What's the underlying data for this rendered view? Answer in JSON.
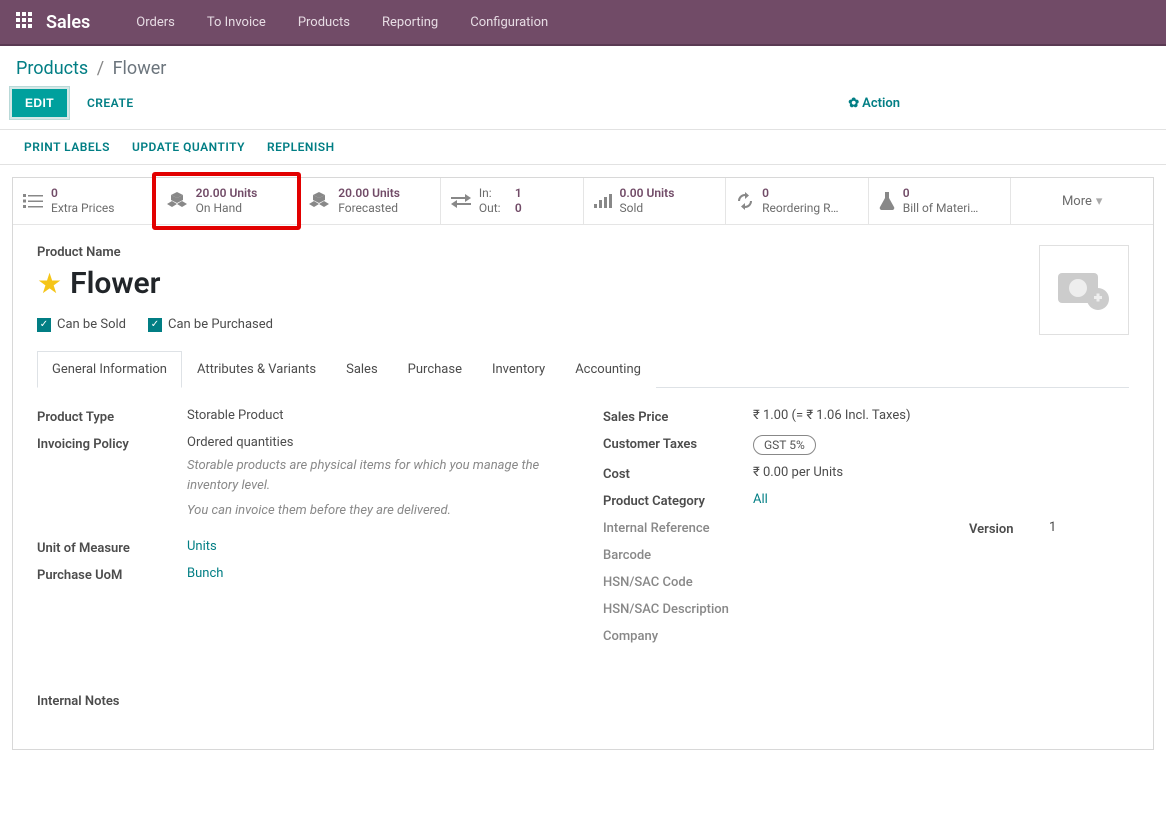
{
  "nav": {
    "app_title": "Sales",
    "items": [
      "Orders",
      "To Invoice",
      "Products",
      "Reporting",
      "Configuration"
    ]
  },
  "breadcrumb": {
    "root": "Products",
    "current": "Flower"
  },
  "actions": {
    "edit": "EDIT",
    "create": "CREATE",
    "action_label": "Action"
  },
  "toolbar2": {
    "print": "PRINT LABELS",
    "update": "UPDATE QUANTITY",
    "replenish": "REPLENISH"
  },
  "stats": {
    "extra_prices": {
      "value": "0",
      "label": "Extra Prices"
    },
    "on_hand": {
      "value": "20.00 Units",
      "label": "On Hand"
    },
    "forecasted": {
      "value": "20.00 Units",
      "label": "Forecasted"
    },
    "inout": {
      "in_label": "In:",
      "in_val": "1",
      "out_label": "Out:",
      "out_val": "0"
    },
    "sold": {
      "value": "0.00 Units",
      "label": "Sold"
    },
    "reordering": {
      "value": "0",
      "label": "Reordering R…"
    },
    "bom": {
      "value": "0",
      "label": "Bill of Materi…"
    },
    "more": "More"
  },
  "product": {
    "name_label": "Product Name",
    "name": "Flower",
    "can_be_sold": "Can be Sold",
    "can_be_purchased": "Can be Purchased"
  },
  "tabs": [
    "General Information",
    "Attributes & Variants",
    "Sales",
    "Purchase",
    "Inventory",
    "Accounting"
  ],
  "fields_left": {
    "product_type": {
      "label": "Product Type",
      "value": "Storable Product"
    },
    "invoicing_policy": {
      "label": "Invoicing Policy",
      "value": "Ordered quantities",
      "hint1": "Storable products are physical items for which you manage the inventory level.",
      "hint2": "You can invoice them before they are delivered."
    },
    "uom": {
      "label": "Unit of Measure",
      "value": "Units"
    },
    "purchase_uom": {
      "label": "Purchase UoM",
      "value": "Bunch"
    }
  },
  "fields_right": {
    "sales_price": {
      "label": "Sales Price",
      "value": "₹ 1.00  (= ₹ 1.06 Incl. Taxes)"
    },
    "customer_taxes": {
      "label": "Customer Taxes",
      "value": "GST 5%"
    },
    "cost": {
      "label": "Cost",
      "value": "₹ 0.00 per Units"
    },
    "category": {
      "label": "Product Category",
      "value": "All"
    },
    "internal_ref": {
      "label": "Internal Reference"
    },
    "barcode": {
      "label": "Barcode"
    },
    "hsn": {
      "label": "HSN/SAC Code"
    },
    "hsn_desc": {
      "label": "HSN/SAC Description"
    },
    "company": {
      "label": "Company"
    },
    "version": {
      "label": "Version",
      "value": "1"
    }
  },
  "internal_notes_label": "Internal Notes"
}
